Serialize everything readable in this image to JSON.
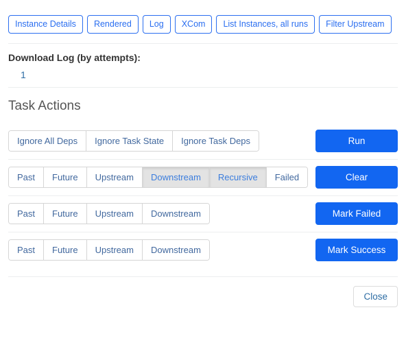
{
  "nav_buttons": [
    {
      "label": "Instance Details",
      "name": "nav-instance-details"
    },
    {
      "label": "Rendered",
      "name": "nav-rendered"
    },
    {
      "label": "Log",
      "name": "nav-log"
    },
    {
      "label": "XCom",
      "name": "nav-xcom"
    },
    {
      "label": "List Instances, all runs",
      "name": "nav-list-instances"
    },
    {
      "label": "Filter Upstream",
      "name": "nav-filter-upstream"
    }
  ],
  "download_log": {
    "title": "Download Log (by attempts):",
    "attempts": [
      "1"
    ]
  },
  "task_actions": {
    "heading": "Task Actions",
    "rows": [
      {
        "name": "run",
        "toggles": [
          {
            "label": "Ignore All Deps",
            "active": false
          },
          {
            "label": "Ignore Task State",
            "active": false
          },
          {
            "label": "Ignore Task Deps",
            "active": false
          }
        ],
        "primary_label": "Run"
      },
      {
        "name": "clear",
        "toggles": [
          {
            "label": "Past",
            "active": false
          },
          {
            "label": "Future",
            "active": false
          },
          {
            "label": "Upstream",
            "active": false
          },
          {
            "label": "Downstream",
            "active": true
          },
          {
            "label": "Recursive",
            "active": true
          },
          {
            "label": "Failed",
            "active": false
          }
        ],
        "primary_label": "Clear"
      },
      {
        "name": "mark-failed",
        "toggles": [
          {
            "label": "Past",
            "active": false
          },
          {
            "label": "Future",
            "active": false
          },
          {
            "label": "Upstream",
            "active": false
          },
          {
            "label": "Downstream",
            "active": false
          }
        ],
        "primary_label": "Mark Failed"
      },
      {
        "name": "mark-success",
        "toggles": [
          {
            "label": "Past",
            "active": false
          },
          {
            "label": "Future",
            "active": false
          },
          {
            "label": "Upstream",
            "active": false
          },
          {
            "label": "Downstream",
            "active": false
          }
        ],
        "primary_label": "Mark Success"
      }
    ]
  },
  "footer": {
    "close_label": "Close"
  },
  "colors": {
    "primary": "#1266f1",
    "outline_primary": "#2a6ef0",
    "link": "#2e6da4",
    "toggle_text": "#41689e",
    "toggle_active_bg": "#e3e3e3",
    "toggle_active_text": "#3b7ddd",
    "divider": "#eceeef"
  }
}
